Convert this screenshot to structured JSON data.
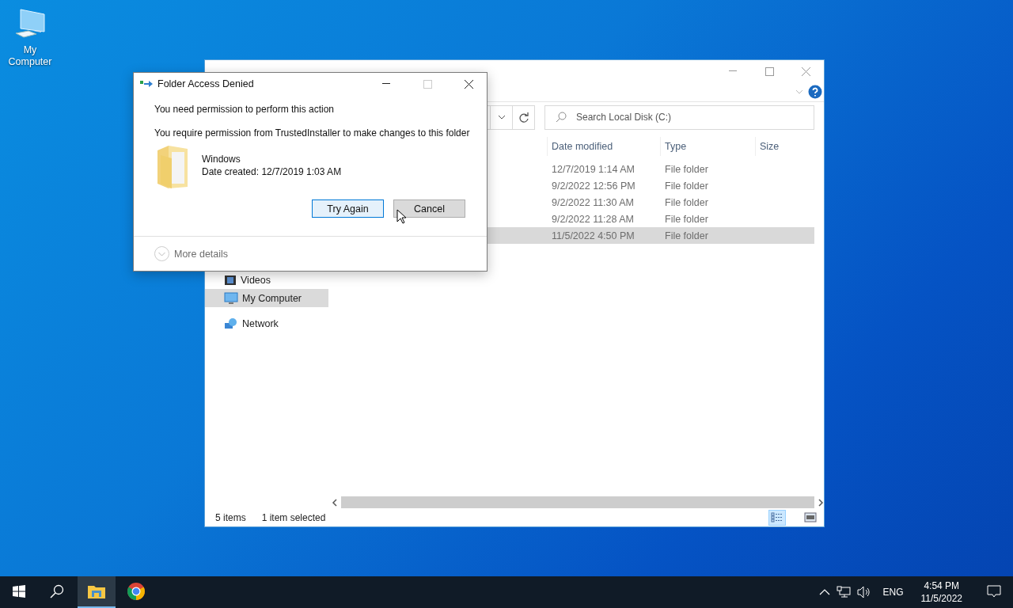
{
  "desktop_icons": [
    {
      "label": "My Computer"
    }
  ],
  "explorer": {
    "search": {
      "placeholder": "Search Local Disk (C:)"
    },
    "columns": [
      "Date modified",
      "Type",
      "Size"
    ],
    "rows": [
      {
        "date_modified": "12/7/2019 1:14 AM",
        "type": "File folder",
        "selected": false
      },
      {
        "date_modified": "9/2/2022 12:56 PM",
        "type": "File folder",
        "selected": false
      },
      {
        "date_modified": "9/2/2022 11:30 AM",
        "type": "File folder",
        "selected": false
      },
      {
        "date_modified": "9/2/2022 11:28 AM",
        "type": "File folder",
        "selected": false
      },
      {
        "date_modified": "11/5/2022 4:50 PM",
        "type": "File folder",
        "selected": true
      }
    ],
    "nav_items": [
      {
        "label": "Videos",
        "kind": "videos",
        "selected": false
      },
      {
        "label": "My Computer",
        "kind": "computer",
        "selected": true
      },
      {
        "label": "Network",
        "kind": "network",
        "selected": false
      }
    ],
    "status_bar": {
      "item_count": "5 items",
      "selection": "1 item selected"
    },
    "views": [
      {
        "kind": "details",
        "selected": true
      },
      {
        "kind": "tiles",
        "selected": false
      }
    ]
  },
  "dialog": {
    "title": "Folder Access Denied",
    "heading": "You need permission to perform this action",
    "message": "You require permission from TrustedInstaller to make changes to this folder",
    "item": {
      "name": "Windows",
      "date_created": "Date created: 12/7/2019 1:03 AM"
    },
    "buttons": [
      {
        "label": "Try Again",
        "focused": true
      },
      {
        "label": "Cancel",
        "focused": false
      }
    ],
    "maximize_disabled": true,
    "more_details": "More details"
  },
  "taskbar": {
    "apps": [
      {
        "kind": "explorer",
        "active": true
      },
      {
        "kind": "chrome",
        "active": false
      }
    ],
    "tray": {
      "language": "ENG",
      "time": "4:54 PM",
      "date": "11/5/2022"
    }
  }
}
